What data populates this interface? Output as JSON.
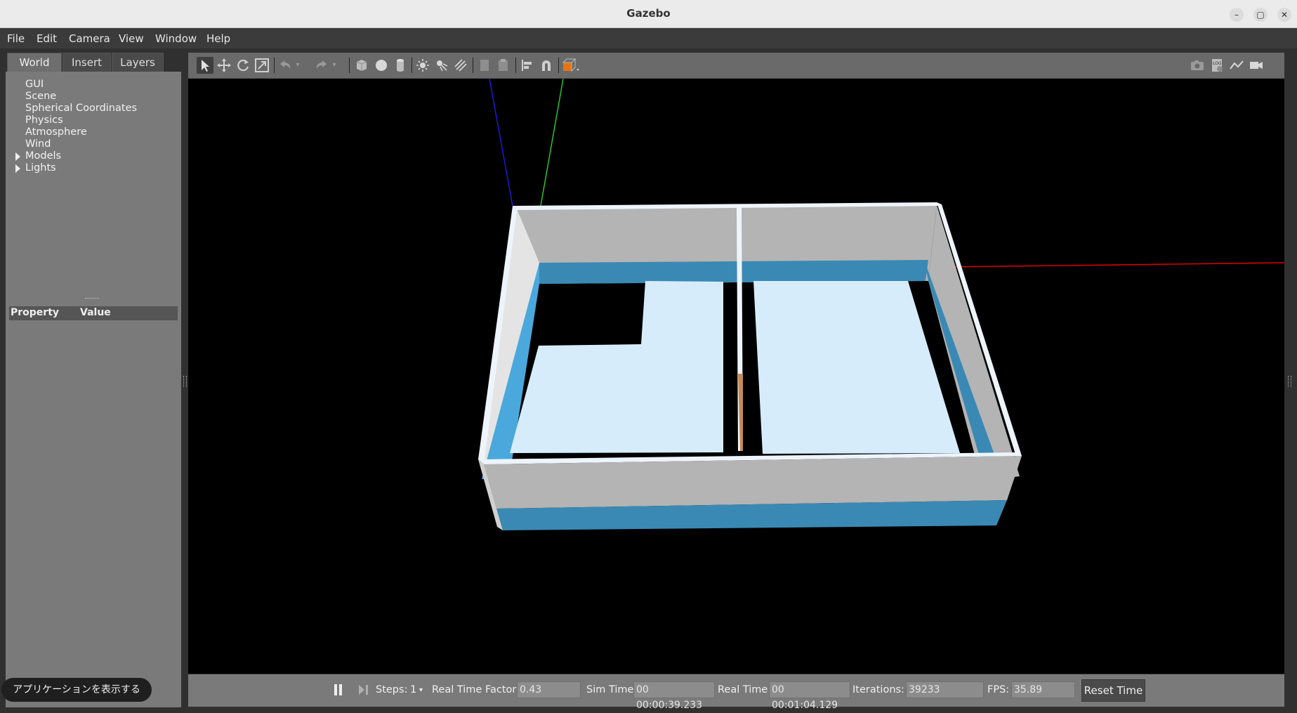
{
  "window": {
    "title": "Gazebo",
    "controls": {
      "minimize": "–",
      "maximize": "▢",
      "close": "✕"
    }
  },
  "menubar": [
    "File",
    "Edit",
    "Camera",
    "View",
    "Window",
    "Help"
  ],
  "left_panel": {
    "tabs": [
      "World",
      "Insert",
      "Layers"
    ],
    "active_tab": "World",
    "tree": [
      "GUI",
      "Scene",
      "Spherical Coordinates",
      "Physics",
      "Atmosphere",
      "Wind",
      "Models",
      "Lights"
    ],
    "expandable": [
      "Models",
      "Lights"
    ],
    "property_header": {
      "property": "Property",
      "value": "Value"
    }
  },
  "toolbar": {
    "left_tools": [
      "select-icon",
      "translate-icon",
      "rotate-icon",
      "scale-icon",
      "undo-icon",
      "redo-icon",
      "box-icon",
      "sphere-icon",
      "cylinder-icon",
      "point-light-icon",
      "spot-light-icon",
      "directional-light-icon",
      "copy-icon",
      "paste-icon",
      "align-icon",
      "snap-icon",
      "view-angle-icon"
    ],
    "right_tools": [
      "screenshot-icon",
      "log-icon",
      "plot-icon",
      "record-video-icon"
    ]
  },
  "bottom_bar": {
    "steps_label": "Steps:",
    "steps_value": "1",
    "rtf_label": "Real Time Factor:",
    "rtf_value": "0.43",
    "sim_time_label": "Sim Time:",
    "sim_time_value": "00 00:00:39.233",
    "real_time_label": "Real Time:",
    "real_time_value": "00 00:01:04.129",
    "iterations_label": "Iterations:",
    "iterations_value": "39233",
    "fps_label": "FPS:",
    "fps_value": "35.89",
    "reset_label": "Reset Time"
  },
  "toast": "アプリケーションを表示する",
  "colors": {
    "wall_top": "#eef4fb",
    "wall_side": "#b4b4b4",
    "wall_base": "#3a89b4",
    "floor": "#d6ecfb",
    "axis_x": "#e00000",
    "axis_y": "#2cc22c",
    "axis_z": "#1a1ad8"
  }
}
